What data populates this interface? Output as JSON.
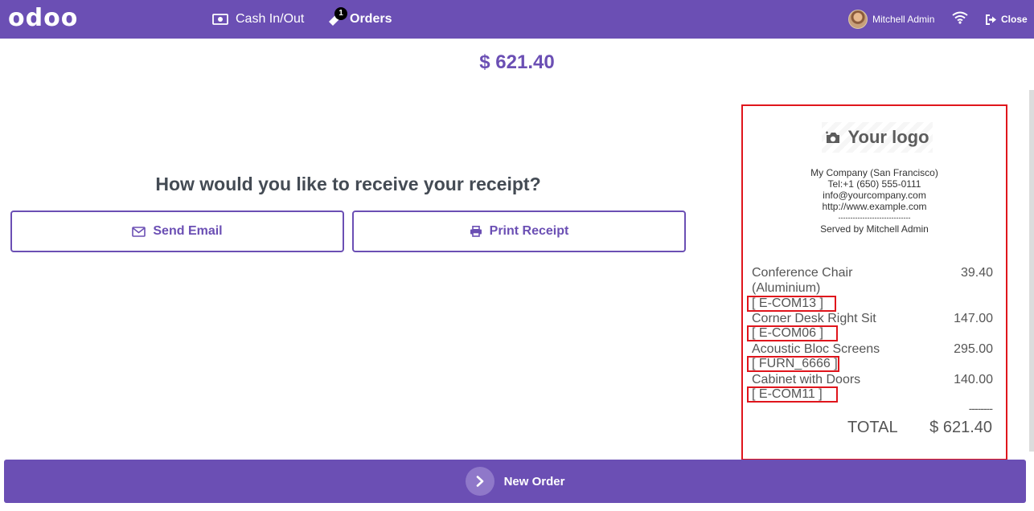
{
  "app": {
    "logo": "odoo"
  },
  "nav": {
    "cash_label": "Cash In/Out",
    "orders_label": "Orders",
    "orders_badge": "1"
  },
  "user": {
    "name": "Mitchell Admin"
  },
  "close_label": "Close",
  "total": {
    "amount": "$ 621.40"
  },
  "receipt_prompt": {
    "question": "How would you like to receive your receipt?",
    "email_label": "Send Email",
    "print_label": "Print Receipt"
  },
  "receipt": {
    "logo_text": "Your logo",
    "company_name": "My Company (San Francisco)",
    "phone": "Tel:+1 (650) 555-0111",
    "email": "info@yourcompany.com",
    "website": "http://www.example.com",
    "separator": "------------------------------",
    "served_by": "Served by Mitchell Admin",
    "lines": [
      {
        "name": "Conference Chair (Aluminium)",
        "price": "39.40",
        "code": "[ E-COM13 ]"
      },
      {
        "name": "Corner Desk Right Sit",
        "price": "147.00",
        "code": "[ E-COM06 ]"
      },
      {
        "name": "Acoustic Bloc Screens",
        "price": "295.00",
        "code": "[ FURN_6666 ]"
      },
      {
        "name": "Cabinet with Doors",
        "price": "140.00",
        "code": "[ E-COM11 ]"
      }
    ],
    "dashes": "--------",
    "total_label": "TOTAL",
    "total_value": "$ 621.40"
  },
  "footer": {
    "new_order_label": "New Order"
  },
  "colors": {
    "brand": "#6b4fb4",
    "highlight": "#e0151c"
  }
}
